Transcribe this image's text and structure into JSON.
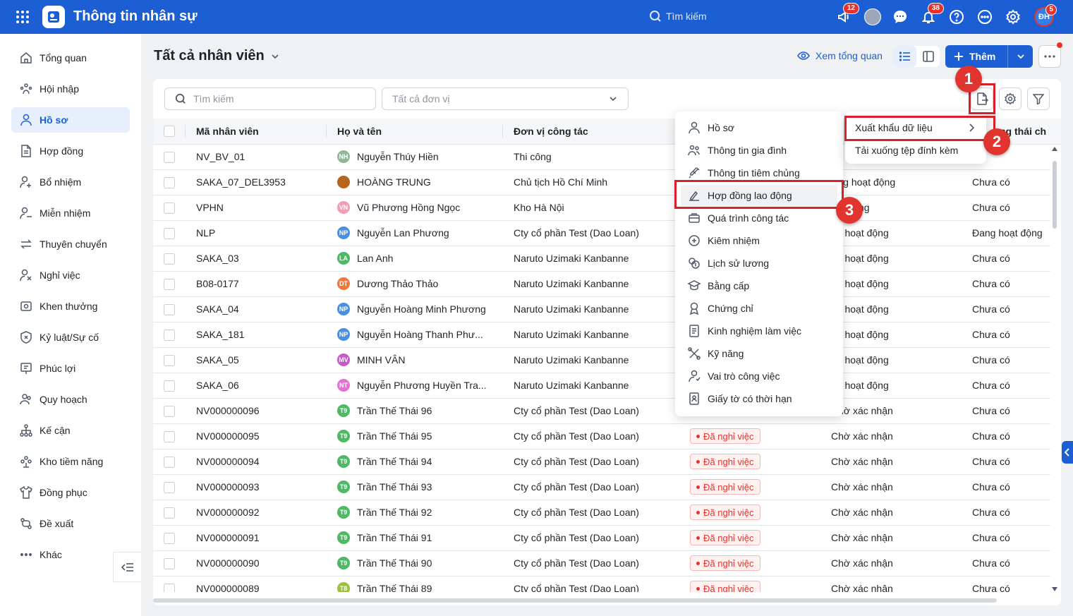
{
  "app": {
    "title": "Thông tin nhân sự",
    "search_label": "Tìm kiếm"
  },
  "topbar": {
    "badges": {
      "megaphone": "12",
      "bell": "38",
      "avatar": "5"
    },
    "user_initials": "ĐH"
  },
  "sidebar": {
    "items": [
      {
        "label": "Tổng quan",
        "icon": "home-icon"
      },
      {
        "label": "Hội nhập",
        "icon": "onboarding-icon"
      },
      {
        "label": "Hồ sơ",
        "icon": "user-icon",
        "active": true
      },
      {
        "label": "Hợp đồng",
        "icon": "document-icon"
      },
      {
        "label": "Bổ nhiệm",
        "icon": "user-plus-icon"
      },
      {
        "label": "Miễn nhiệm",
        "icon": "user-minus-icon"
      },
      {
        "label": "Thuyên chuyển",
        "icon": "transfer-icon"
      },
      {
        "label": "Nghỉ việc",
        "icon": "user-x-icon"
      },
      {
        "label": "Khen thưởng",
        "icon": "award-icon"
      },
      {
        "label": "Kỷ luật/Sự cố",
        "icon": "shield-x-icon"
      },
      {
        "label": "Phúc lợi",
        "icon": "gift-icon"
      },
      {
        "label": "Quy hoạch",
        "icon": "planning-icon"
      },
      {
        "label": "Kế cận",
        "icon": "hierarchy-icon"
      },
      {
        "label": "Kho tiềm năng",
        "icon": "talent-pool-icon"
      },
      {
        "label": "Đồng phục",
        "icon": "shirt-icon"
      },
      {
        "label": "Đề xuất",
        "icon": "proposal-icon"
      },
      {
        "label": "Khác",
        "icon": "more-horizontal-icon"
      }
    ]
  },
  "header": {
    "title": "Tất cả nhân viên",
    "overview_label": "Xem tổng quan",
    "add_label": "Thêm"
  },
  "filters": {
    "search_placeholder": "Tìm kiếm",
    "unit_placeholder": "Tất cả đơn vị"
  },
  "table": {
    "columns": [
      "Mã nhân viên",
      "Họ và tên",
      "Đơn vị công tác",
      "",
      "",
      "ng thái ch"
    ],
    "rows": [
      {
        "code": "NV_BV_01",
        "initials": "NH",
        "avatar_color": "#8fb996",
        "name": "Nguyễn Thúy Hiền",
        "unit": "Thi công",
        "status_tag": "",
        "work_status": "",
        "contract": "Có"
      },
      {
        "code": "SAKA_07_DEL3953",
        "initials": "",
        "avatar_color": "#b5651d",
        "name": "HOÀNG TRUNG",
        "unit": "Chủ tịch Hồ Chí Minh",
        "status_tag": "",
        "work_status": "ừng hoạt động",
        "contract": "Chưa có"
      },
      {
        "code": "VPHN",
        "initials": "VN",
        "avatar_color": "#f59bb5",
        "name": "Vũ Phương Hồng Ngọc",
        "unit": "Kho Hà Nội",
        "status_tag": "",
        "work_status": "oạt động",
        "contract": "Chưa có"
      },
      {
        "code": "NLP",
        "initials": "NP",
        "avatar_color": "#4a90e2",
        "name": "Nguyễn Lan Phương",
        "unit": "Cty cổ phần Test (Dao Loan)",
        "status_tag": "",
        "work_status": "ng hoạt động",
        "contract": "Đang hoạt động"
      },
      {
        "code": "SAKA_03",
        "initials": "LA",
        "avatar_color": "#4cb963",
        "name": "Lan Anh",
        "unit": "Naruto Uzimaki Kanbanne",
        "status_tag": "",
        "work_status": "ng hoạt động",
        "contract": "Chưa có"
      },
      {
        "code": "B08-0177",
        "initials": "DT",
        "avatar_color": "#f0793a",
        "name": "Dương Thảo Thảo",
        "unit": "Naruto Uzimaki Kanbanne",
        "status_tag": "",
        "work_status": "ng hoạt động",
        "contract": "Chưa có"
      },
      {
        "code": "SAKA_04",
        "initials": "NP",
        "avatar_color": "#4a90e2",
        "name": "Nguyễn Hoàng Minh Phương",
        "unit": "Naruto Uzimaki Kanbanne",
        "status_tag": "",
        "work_status": "ng hoạt động",
        "contract": "Chưa có"
      },
      {
        "code": "SAKA_181",
        "initials": "NP",
        "avatar_color": "#4a90e2",
        "name": "Nguyễn Hoàng Thanh Phư...",
        "unit": "Naruto Uzimaki Kanbanne",
        "status_tag": "",
        "work_status": "ng hoạt động",
        "contract": "Chưa có"
      },
      {
        "code": "SAKA_05",
        "initials": "MV",
        "avatar_color": "#c758c9",
        "name": "MINH VÂN",
        "unit": "Naruto Uzimaki Kanbanne",
        "status_tag": "",
        "work_status": "ng hoạt động",
        "contract": "Chưa có"
      },
      {
        "code": "SAKA_06",
        "initials": "NT",
        "avatar_color": "#e86fd3",
        "name": "Nguyễn Phương Huyền Tra...",
        "unit": "Naruto Uzimaki Kanbanne",
        "status_tag": "",
        "work_status": "ng hoạt động",
        "contract": "Chưa có"
      },
      {
        "code": "NV000000096",
        "initials": "T9",
        "avatar_color": "#4cb963",
        "name": "Trần Thế Thái 96",
        "unit": "Cty cổ phần Test (Dao Loan)",
        "status_tag": "",
        "work_status": "Chờ xác nhận",
        "contract": "Chưa có"
      },
      {
        "code": "NV000000095",
        "initials": "T9",
        "avatar_color": "#4cb963",
        "name": "Trần Thế Thái 95",
        "unit": "Cty cổ phần Test (Dao Loan)",
        "status_tag": "Đã nghỉ việc",
        "work_status": "Chờ xác nhận",
        "contract": "Chưa có"
      },
      {
        "code": "NV000000094",
        "initials": "T9",
        "avatar_color": "#4cb963",
        "name": "Trần Thế Thái 94",
        "unit": "Cty cổ phần Test (Dao Loan)",
        "status_tag": "Đã nghỉ việc",
        "work_status": "Chờ xác nhận",
        "contract": "Chưa có"
      },
      {
        "code": "NV000000093",
        "initials": "T9",
        "avatar_color": "#4cb963",
        "name": "Trần Thế Thái 93",
        "unit": "Cty cổ phần Test (Dao Loan)",
        "status_tag": "Đã nghỉ việc",
        "work_status": "Chờ xác nhận",
        "contract": "Chưa có"
      },
      {
        "code": "NV000000092",
        "initials": "T9",
        "avatar_color": "#4cb963",
        "name": "Trần Thế Thái 92",
        "unit": "Cty cổ phần Test (Dao Loan)",
        "status_tag": "Đã nghỉ việc",
        "work_status": "Chờ xác nhận",
        "contract": "Chưa có"
      },
      {
        "code": "NV000000091",
        "initials": "T9",
        "avatar_color": "#4cb963",
        "name": "Trần Thế Thái 91",
        "unit": "Cty cổ phần Test (Dao Loan)",
        "status_tag": "Đã nghỉ việc",
        "work_status": "Chờ xác nhận",
        "contract": "Chưa có"
      },
      {
        "code": "NV000000090",
        "initials": "T9",
        "avatar_color": "#4cb963",
        "name": "Trần Thế Thái 90",
        "unit": "Cty cổ phần Test (Dao Loan)",
        "status_tag": "Đã nghỉ việc",
        "work_status": "Chờ xác nhận",
        "contract": "Chưa có"
      },
      {
        "code": "NV000000089",
        "initials": "T8",
        "avatar_color": "#9bc23c",
        "name": "Trần Thế Thái 89",
        "unit": "Cty cổ phần Test (Dao Loan)",
        "status_tag": "Đã nghỉ việc",
        "work_status": "Chờ xác nhận",
        "contract": "Chưa có"
      }
    ]
  },
  "export_menu": {
    "items": [
      {
        "label": "Hồ sơ",
        "icon": "user-icon"
      },
      {
        "label": "Thông tin gia đình",
        "icon": "family-icon"
      },
      {
        "label": "Thông tin tiêm chủng",
        "icon": "syringe-icon"
      },
      {
        "label": "Hợp đồng lao động",
        "icon": "contract-sign-icon",
        "highlighted": true
      },
      {
        "label": "Quá trình công tác",
        "icon": "briefcase-icon"
      },
      {
        "label": "Kiêm nhiệm",
        "icon": "concurrent-role-icon"
      },
      {
        "label": "Lịch sử lương",
        "icon": "coins-icon"
      },
      {
        "label": "Bằng cấp",
        "icon": "graduation-cap-icon"
      },
      {
        "label": "Chứng chỉ",
        "icon": "certificate-icon"
      },
      {
        "label": "Kinh nghiệm làm việc",
        "icon": "file-text-icon"
      },
      {
        "label": "Kỹ năng",
        "icon": "skills-icon"
      },
      {
        "label": "Vai trò công việc",
        "icon": "user-role-icon"
      },
      {
        "label": "Giấy tờ có thời hạn",
        "icon": "id-document-icon"
      }
    ]
  },
  "data_submenu": {
    "items": [
      {
        "label": "Xuất khẩu dữ liệu",
        "has_arrow": true
      },
      {
        "label": "Tải xuống tệp đính kèm",
        "has_arrow": false
      }
    ]
  },
  "annotations": {
    "step1": "1",
    "step2": "2",
    "step3": "3"
  },
  "colors": {
    "primary": "#1c5fd4",
    "danger": "#e5322d",
    "annotation": "#d8202a"
  }
}
